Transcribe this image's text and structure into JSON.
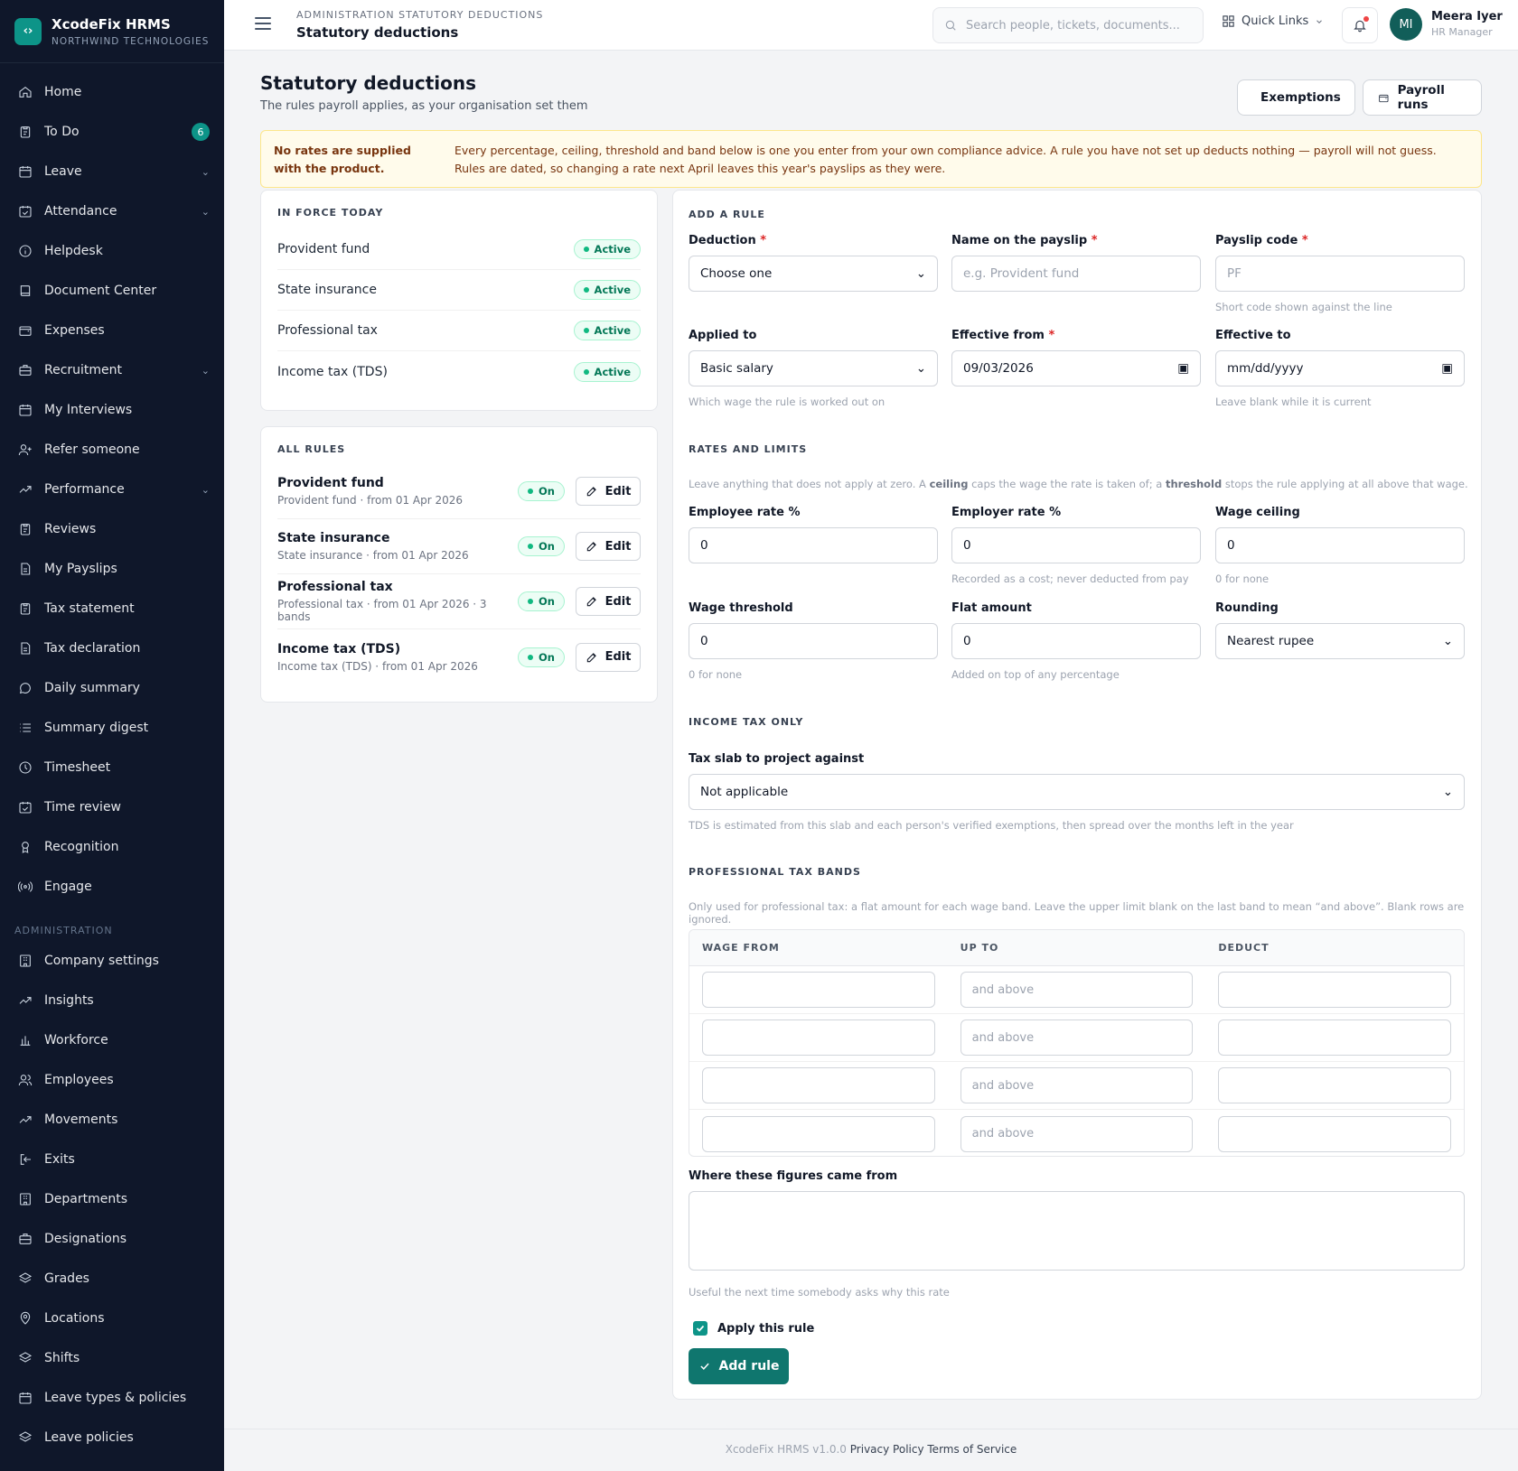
{
  "app": {
    "name": "XcodeFix HRMS",
    "company": "NORTHWIND TECHNOLOGIES"
  },
  "sidebar": {
    "items": [
      {
        "label": "Home",
        "icon": "home-icon"
      },
      {
        "label": "To Do",
        "icon": "clipboard-icon",
        "badge": "6"
      },
      {
        "label": "Leave",
        "icon": "calendar-icon",
        "chevron": true
      },
      {
        "label": "Attendance",
        "icon": "calendar-check-icon",
        "chevron": true
      },
      {
        "label": "Helpdesk",
        "icon": "info-icon"
      },
      {
        "label": "Document Center",
        "icon": "book-icon"
      },
      {
        "label": "Expenses",
        "icon": "wallet-icon"
      },
      {
        "label": "Recruitment",
        "icon": "briefcase-icon",
        "chevron": true
      },
      {
        "label": "My Interviews",
        "icon": "calendar-icon"
      },
      {
        "label": "Refer someone",
        "icon": "user-plus-icon"
      },
      {
        "label": "Performance",
        "icon": "trending-up-icon",
        "chevron": true
      },
      {
        "label": "Reviews",
        "icon": "clipboard-icon"
      },
      {
        "label": "My Payslips",
        "icon": "file-icon"
      },
      {
        "label": "Tax statement",
        "icon": "clipboard-icon"
      },
      {
        "label": "Tax declaration",
        "icon": "file-icon"
      },
      {
        "label": "Daily summary",
        "icon": "message-icon"
      },
      {
        "label": "Summary digest",
        "icon": "list-icon"
      },
      {
        "label": "Timesheet",
        "icon": "clock-icon"
      },
      {
        "label": "Time review",
        "icon": "calendar-check-icon"
      },
      {
        "label": "Recognition",
        "icon": "award-icon"
      },
      {
        "label": "Engage",
        "icon": "broadcast-icon"
      }
    ],
    "admin_section": "ADMINISTRATION",
    "admin_items": [
      {
        "label": "Company settings",
        "icon": "building-icon"
      },
      {
        "label": "Insights",
        "icon": "trending-up-icon"
      },
      {
        "label": "Workforce",
        "icon": "bar-chart-icon"
      },
      {
        "label": "Employees",
        "icon": "users-icon"
      },
      {
        "label": "Movements",
        "icon": "trending-up-icon"
      },
      {
        "label": "Exits",
        "icon": "log-out-icon"
      },
      {
        "label": "Departments",
        "icon": "building-icon"
      },
      {
        "label": "Designations",
        "icon": "briefcase-icon"
      },
      {
        "label": "Grades",
        "icon": "layers-icon"
      },
      {
        "label": "Locations",
        "icon": "map-pin-icon"
      },
      {
        "label": "Shifts",
        "icon": "layers-icon"
      },
      {
        "label": "Leave types & policies",
        "icon": "calendar-icon"
      },
      {
        "label": "Leave policies",
        "icon": "layers-icon"
      }
    ]
  },
  "topbar": {
    "breadcrumb": "ADMINISTRATION STATUTORY DEDUCTIONS",
    "title": "Statutory deductions",
    "search_placeholder": "Search people, tickets, documents...",
    "quick_links": "Quick Links",
    "user_initials": "MI",
    "user_name": "Meera Iyer",
    "user_role": "HR Manager"
  },
  "page": {
    "title": "Statutory deductions",
    "subtitle": "The rules payroll applies, as your organisation set them",
    "exemptions_button": "Exemptions",
    "payroll_runs_button": "Payroll runs"
  },
  "notice": {
    "title": "No rates are supplied with the product.",
    "body": "Every percentage, ceiling, threshold and band below is one you enter from your own compliance advice. A rule you have not set up deducts nothing — payroll will not guess. Rules are dated, so changing a rate next April leaves this year's payslips as they were."
  },
  "in_force": {
    "heading": "IN FORCE TODAY",
    "items": [
      {
        "name": "Provident fund",
        "status": "Active"
      },
      {
        "name": "State insurance",
        "status": "Active"
      },
      {
        "name": "Professional tax",
        "status": "Active"
      },
      {
        "name": "Income tax (TDS)",
        "status": "Active"
      }
    ]
  },
  "all_rules": {
    "heading": "ALL RULES",
    "edit_label": "Edit",
    "items": [
      {
        "name": "Provident fund",
        "meta": "Provident fund · from 01 Apr 2026",
        "status": "On"
      },
      {
        "name": "State insurance",
        "meta": "State insurance · from 01 Apr 2026",
        "status": "On"
      },
      {
        "name": "Professional tax",
        "meta": "Professional tax · from 01 Apr 2026 · 3 bands",
        "status": "On"
      },
      {
        "name": "Income tax (TDS)",
        "meta": "Income tax (TDS) · from 01 Apr 2026",
        "status": "On"
      }
    ]
  },
  "form": {
    "heading": "ADD A RULE",
    "deduction": {
      "label": "Deduction",
      "value": "Choose one"
    },
    "payslip_name": {
      "label": "Name on the payslip",
      "placeholder": "e.g. Provident fund"
    },
    "payslip_code": {
      "label": "Payslip code",
      "placeholder": "PF",
      "hint": "Short code shown against the line"
    },
    "applied_to": {
      "label": "Applied to",
      "value": "Basic salary",
      "hint": "Which wage the rule is worked out on"
    },
    "effective_from": {
      "label": "Effective from",
      "value": "09/03/2026"
    },
    "effective_to": {
      "label": "Effective to",
      "value": "mm/dd/yyyy",
      "hint": "Leave blank while it is current"
    },
    "rates_heading": "RATES AND LIMITS",
    "rates_note_1": "Leave anything that does not apply at zero. A ",
    "rates_note_ceiling": "ceiling",
    "rates_note_2": " caps the wage the rate is taken of; a ",
    "rates_note_threshold": "threshold",
    "rates_note_3": " stops the rule applying at all above that wage.",
    "employee_rate": {
      "label": "Employee rate %",
      "value": "0"
    },
    "employer_rate": {
      "label": "Employer rate %",
      "value": "0",
      "hint": "Recorded as a cost; never deducted from pay"
    },
    "wage_ceiling": {
      "label": "Wage ceiling",
      "value": "0",
      "hint": "0 for none"
    },
    "wage_threshold": {
      "label": "Wage threshold",
      "value": "0",
      "hint": "0 for none"
    },
    "flat_amount": {
      "label": "Flat amount",
      "value": "0",
      "hint": "Added on top of any percentage"
    },
    "rounding": {
      "label": "Rounding",
      "value": "Nearest rupee"
    },
    "income_tax_heading": "INCOME TAX ONLY",
    "tax_slab": {
      "label": "Tax slab to project against",
      "value": "Not applicable",
      "hint": "TDS is estimated from this slab and each person's verified exemptions, then spread over the months left in the year"
    },
    "bands_heading": "PROFESSIONAL TAX BANDS",
    "bands_note": "Only used for professional tax: a flat amount for each wage band. Leave the upper limit blank on the last band to mean “and above”. Blank rows are ignored.",
    "bands_columns": [
      "WAGE FROM",
      "UP TO",
      "DEDUCT"
    ],
    "bands_upto_placeholder": "and above",
    "source_label": "Where these figures came from",
    "source_hint": "Useful the next time somebody asks why this rate",
    "apply_label": "Apply this rule",
    "apply_checked": true,
    "submit_label": "Add rule"
  },
  "footer": {
    "version": "XcodeFix HRMS v1.0.0",
    "privacy": "Privacy Policy",
    "terms": "Terms of Service"
  },
  "colors": {
    "accent": "#0d9488",
    "sidebar_bg": "#0f172a",
    "notice_bg": "#fffbeb",
    "success": "#047857"
  }
}
